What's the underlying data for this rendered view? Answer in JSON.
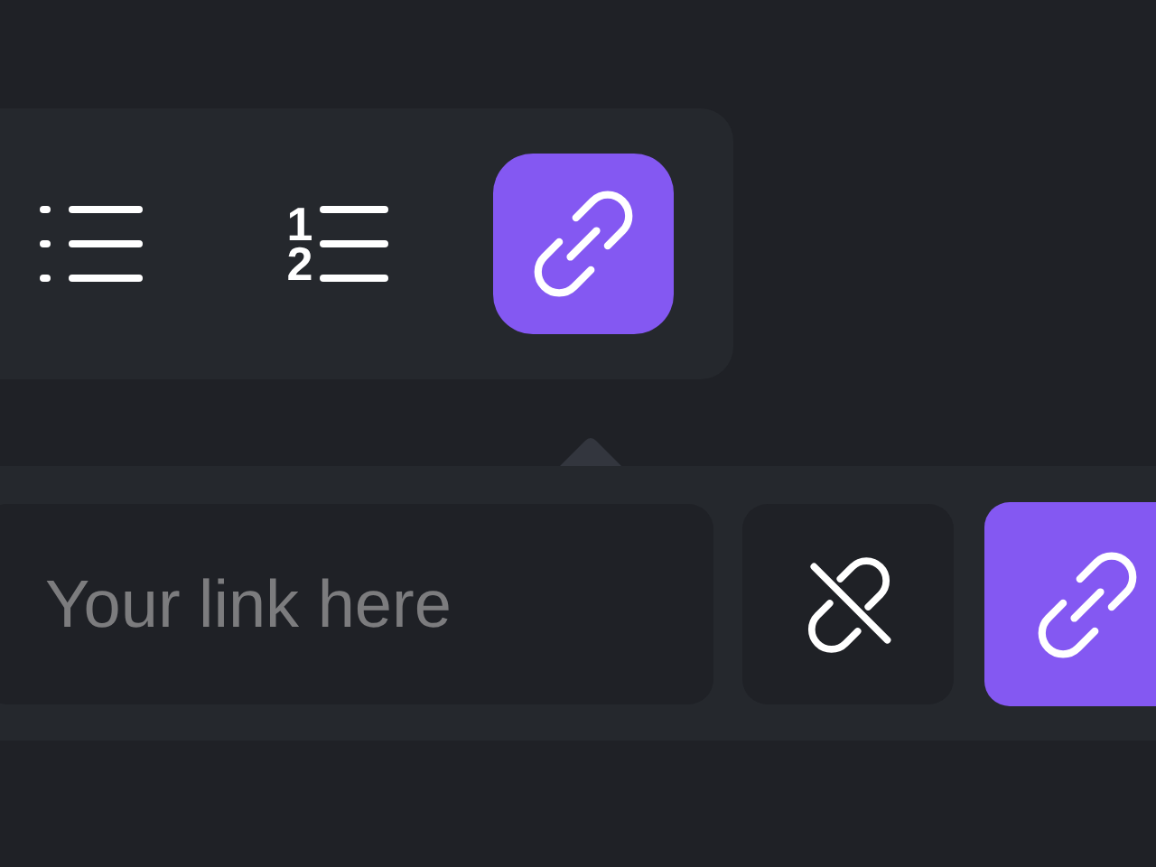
{
  "toolbar": {
    "buttons": [
      {
        "kind": "bullet-list",
        "selected": false
      },
      {
        "kind": "numbered-list",
        "selected": false,
        "markers": [
          "1",
          "2"
        ]
      },
      {
        "kind": "link",
        "selected": true
      }
    ]
  },
  "link_popover": {
    "field": {
      "placeholder": "Your link here"
    },
    "buttons": [
      {
        "kind": "unlink"
      },
      {
        "kind": "link"
      }
    ]
  }
}
